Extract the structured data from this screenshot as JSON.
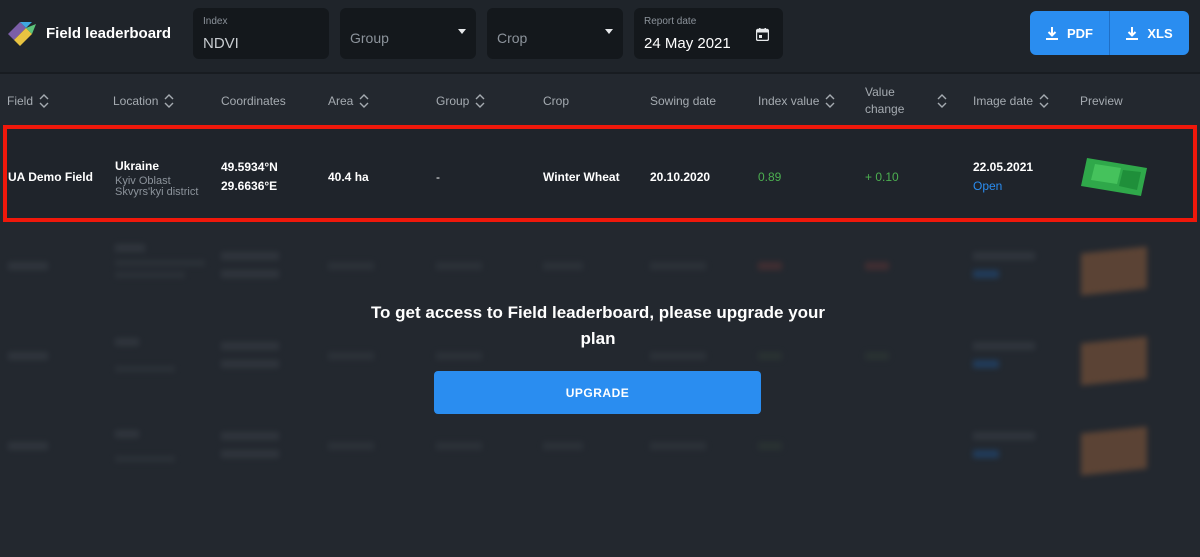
{
  "app": {
    "title": "Field leaderboard"
  },
  "filters": {
    "index": {
      "label": "Index",
      "value": "NDVI"
    },
    "group": {
      "placeholder": "Group"
    },
    "crop": {
      "placeholder": "Crop"
    },
    "report_date": {
      "label": "Report date",
      "value": "24 May 2021"
    }
  },
  "export": {
    "pdf_label": "PDF",
    "xls_label": "XLS"
  },
  "table": {
    "columns": [
      {
        "label": "Field",
        "sortable": true
      },
      {
        "label": "Location",
        "sortable": true
      },
      {
        "label": "Coordinates",
        "sortable": false
      },
      {
        "label": "Area",
        "sortable": true
      },
      {
        "label": "Group",
        "sortable": true
      },
      {
        "label": "Crop",
        "sortable": false
      },
      {
        "label": "Sowing date",
        "sortable": false
      },
      {
        "label": "Index value",
        "sortable": true
      },
      {
        "label": "Value change",
        "sortable": true
      },
      {
        "label": "Image date",
        "sortable": true
      },
      {
        "label": "Preview",
        "sortable": false
      }
    ],
    "rows": [
      {
        "field": "UA Demo Field",
        "location_country": "Ukraine",
        "location_region": "Kyiv Oblast",
        "location_district": "Skvyrs'kyi district",
        "lat": "49.5934°N",
        "lon": "29.6636°E",
        "area": "40.4 ha",
        "group": "-",
        "crop": "Winter Wheat",
        "sowing_date": "20.10.2020",
        "index_value": "0.89",
        "value_change": "+ 0.10",
        "image_date": "22.05.2021",
        "image_link": "Open"
      }
    ]
  },
  "paywall": {
    "message": "To get access to Field leaderboard, please upgrade your plan",
    "button_label": "UPGRADE"
  },
  "colors": {
    "accent": "#2a8df0",
    "highlight": "#f0180b",
    "positive": "#4caf50",
    "background": "#23282f"
  }
}
